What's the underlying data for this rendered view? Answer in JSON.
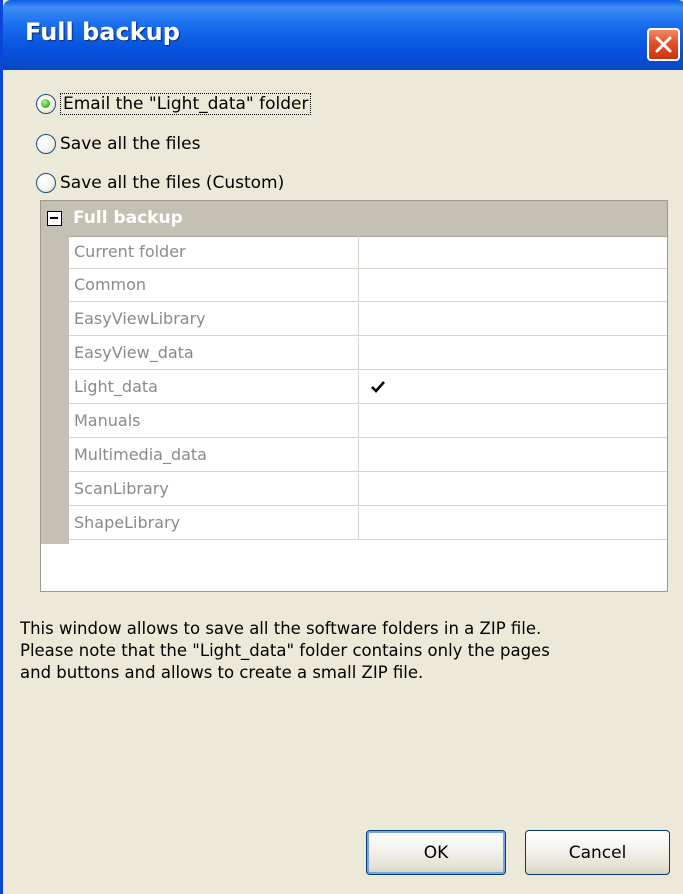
{
  "window": {
    "title": "Full backup",
    "close_icon": "close-icon",
    "colors": {
      "titlebar": "#0752dc",
      "close": "#e0502a",
      "body": "#ece9d8"
    }
  },
  "options": [
    {
      "label": "Email the \"Light_data\" folder",
      "selected": true
    },
    {
      "label": "Save all the files",
      "selected": false
    },
    {
      "label": "Save all the files (Custom)",
      "selected": false
    }
  ],
  "tree": {
    "header": "Full backup",
    "toggle_icon": "collapse-minus-icon",
    "rows": [
      {
        "name": "Current folder",
        "checked": false
      },
      {
        "name": "Common",
        "checked": false
      },
      {
        "name": "EasyViewLibrary",
        "checked": false
      },
      {
        "name": "EasyView_data",
        "checked": false
      },
      {
        "name": "Light_data",
        "checked": true
      },
      {
        "name": "Manuals",
        "checked": false
      },
      {
        "name": "Multimedia_data",
        "checked": false
      },
      {
        "name": "ScanLibrary",
        "checked": false
      },
      {
        "name": "ShapeLibrary",
        "checked": false
      }
    ]
  },
  "description": [
    "This window allows to save all the software folders in a ZIP file.",
    "Please note that the \"Light_data\" folder contains only the pages",
    "and buttons and allows to create a small ZIP file."
  ],
  "buttons": {
    "ok": "OK",
    "cancel": "Cancel"
  }
}
